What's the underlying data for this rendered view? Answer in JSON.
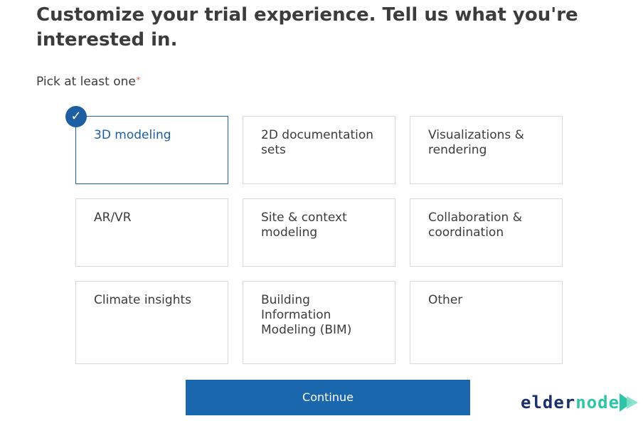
{
  "header": {
    "title": "Customize your trial experience. Tell us what you're interested in."
  },
  "prompt": {
    "label": "Pick at least one",
    "required_mark": "*"
  },
  "options": [
    {
      "label": "3D modeling",
      "selected": true
    },
    {
      "label": "2D documentation sets",
      "selected": false
    },
    {
      "label": "Visualizations & rendering",
      "selected": false
    },
    {
      "label": "AR/VR",
      "selected": false
    },
    {
      "label": "Site & context modeling",
      "selected": false
    },
    {
      "label": "Collaboration & coordination",
      "selected": false
    },
    {
      "label": "Climate insights",
      "selected": false
    },
    {
      "label": "Building Information Modeling (BIM)",
      "selected": false
    },
    {
      "label": "Other",
      "selected": false
    }
  ],
  "selected_icon": "checkmark-icon",
  "continue_button": {
    "label": "Continue"
  },
  "watermark": {
    "part1": "elder",
    "part2": "node",
    "icon": "play-arrows-icon"
  },
  "colors": {
    "accent": "#1d5fa0",
    "button": "#1b67ad",
    "text": "#3c3c3c",
    "border": "#d9d9d9",
    "required": "#e0533b"
  }
}
